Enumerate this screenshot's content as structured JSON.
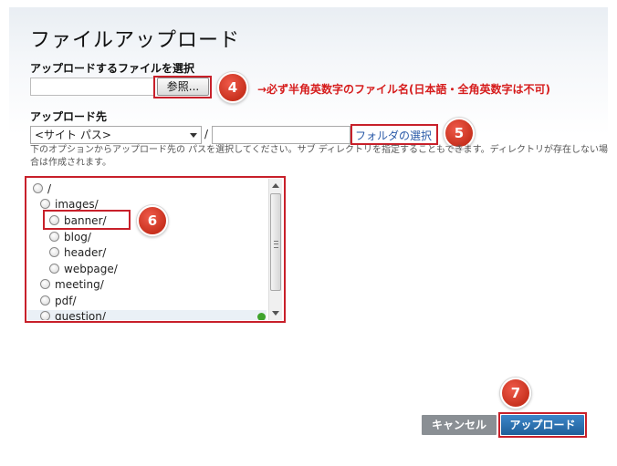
{
  "page": {
    "title": "ファイルアップロード"
  },
  "file_section": {
    "label": "アップロードするファイルを選択",
    "file_value": "",
    "browse_label": "参照..."
  },
  "annotations": {
    "b4": "4",
    "b5": "5",
    "b6": "6",
    "b7": "7",
    "note": "→必ず半角英数字のファイル名(日本語・全角英数字は不可)"
  },
  "destination": {
    "label": "アップロード先",
    "select_value": "<サイト パス>",
    "slash": "/",
    "path_value": "",
    "folder_link": "フォルダの選択",
    "help": "下のオプションからアップロード先の パスを選択してください。サブ ディレクトリを指定することもできます。ディレクトリが存在しない場合は作成されます。"
  },
  "tree": {
    "nodes": [
      {
        "label": "/"
      },
      {
        "label": "images/"
      },
      {
        "label": "banner/"
      },
      {
        "label": "blog/"
      },
      {
        "label": "header/"
      },
      {
        "label": "webpage/"
      },
      {
        "label": "meeting/"
      },
      {
        "label": "pdf/"
      },
      {
        "label": "question/"
      }
    ]
  },
  "buttons": {
    "cancel": "キャンセル",
    "upload": "アップロード"
  },
  "colors": {
    "accent_red": "#c8202a",
    "primary_button": "#2a6fad",
    "secondary_button": "#8a8f94",
    "link": "#2a5aa8"
  }
}
